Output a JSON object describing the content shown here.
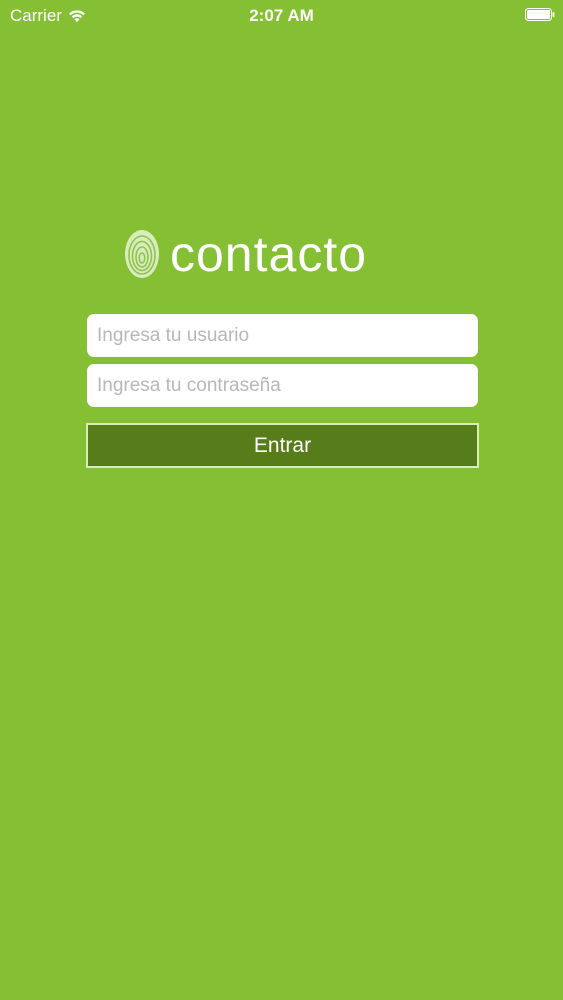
{
  "status_bar": {
    "carrier": "Carrier",
    "time": "2:07 AM",
    "wifi_icon": "wifi-icon",
    "battery_icon": "battery-icon"
  },
  "logo": {
    "text": "contacto",
    "icon": "fingerprint-icon"
  },
  "form": {
    "username_placeholder": "Ingresa tu usuario",
    "username_value": "",
    "password_placeholder": "Ingresa tu contraseña",
    "password_value": "",
    "submit_label": "Entrar"
  },
  "colors": {
    "background": "#85bf33",
    "button": "#567d1a",
    "button_border": "#d9eac0",
    "text": "#ffffff"
  }
}
